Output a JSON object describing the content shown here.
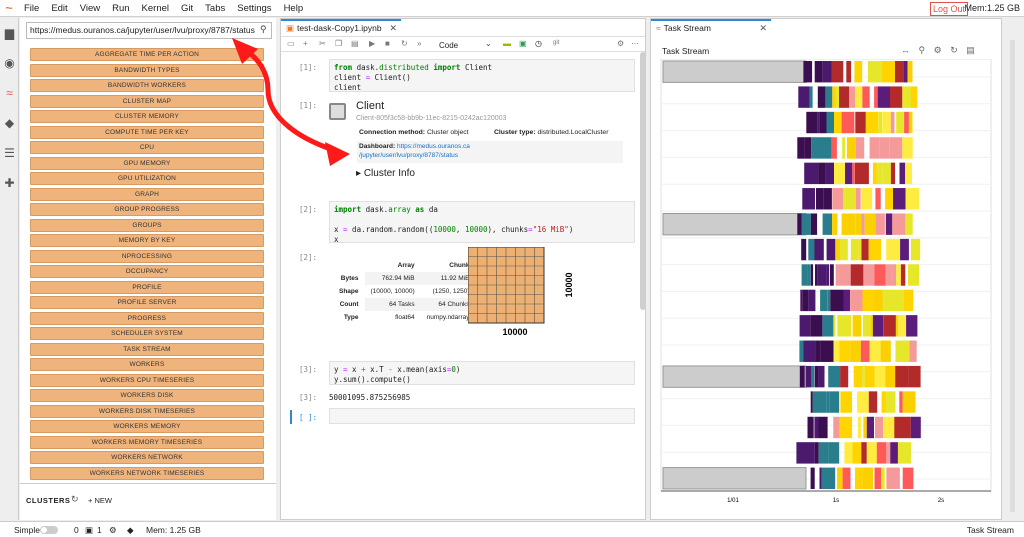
{
  "menubar": {
    "items": [
      "File",
      "Edit",
      "View",
      "Run",
      "Kernel",
      "Git",
      "Tabs",
      "Settings",
      "Help"
    ],
    "logout": "Log Out",
    "memory": "Mem:1.25 GB"
  },
  "leftpanel": {
    "url": "https://medus.ouranos.ca/jupyter/user/lvu/proxy/8787/status",
    "buttons": [
      "AGGREGATE TIME PER ACTION",
      "BANDWIDTH TYPES",
      "BANDWIDTH WORKERS",
      "CLUSTER MAP",
      "CLUSTER MEMORY",
      "COMPUTE TIME PER KEY",
      "CPU",
      "GPU MEMORY",
      "GPU UTILIZATION",
      "GRAPH",
      "GROUP PROGRESS",
      "GROUPS",
      "MEMORY BY KEY",
      "NPROCESSING",
      "OCCUPANCY",
      "PROFILE",
      "PROFILE SERVER",
      "PROGRESS",
      "SCHEDULER SYSTEM",
      "TASK STREAM",
      "WORKERS",
      "WORKERS CPU TIMESERIES",
      "WORKERS DISK",
      "WORKERS DISK TIMESERIES",
      "WORKERS MEMORY",
      "WORKERS MEMORY TIMESERIES",
      "WORKERS NETWORK",
      "WORKERS NETWORK TIMESERIES"
    ],
    "clusters_title": "CLUSTERS",
    "new_label": "NEW"
  },
  "notebook": {
    "tab": "test-dask-Copy1.ipynb",
    "cell_type": "Code",
    "git_label": "git",
    "prompts": [
      "[1]:",
      "[1]:",
      "[2]:",
      "[2]:",
      "[3]:",
      "[3]:",
      "[ ]:"
    ],
    "client_title": "Client",
    "client_id": "Client-805f3c58-bb9b-11ec-8215-0242ac120003",
    "conn_method_label": "Connection method:",
    "conn_method_value": "Cluster object",
    "cluster_type_label": "Cluster type:",
    "cluster_type_value": "distributed.LocalCluster",
    "dashboard_label": "Dashboard:",
    "dashboard_link_1": "https://medus.ouranos.ca",
    "dashboard_link_2": "/jupyter/user/lvu/proxy/8787/status",
    "cluster_info": "Cluster Info",
    "table": {
      "headers": [
        "",
        "Array",
        "Chunk"
      ],
      "rows": [
        [
          "Bytes",
          "762.94 MiB",
          "11.92 MiB"
        ],
        [
          "Shape",
          "(10000, 10000)",
          "(1250, 1250)"
        ],
        [
          "Count",
          "64 Tasks",
          "64 Chunks"
        ],
        [
          "Type",
          "float64",
          "numpy.ndarray"
        ]
      ]
    },
    "grid_x_label": "10000",
    "grid_y_label": "10000",
    "output_3": "50001095.875256985"
  },
  "taskstream": {
    "tab": "Task Stream",
    "title": "Task Stream",
    "x_ticks": [
      "1/01",
      "1s",
      "2s"
    ]
  },
  "statusbar": {
    "mode": "Simple",
    "kernels": "0",
    "terminals": "1",
    "memory": "Mem: 1.25 GB",
    "right": "Task Stream"
  }
}
